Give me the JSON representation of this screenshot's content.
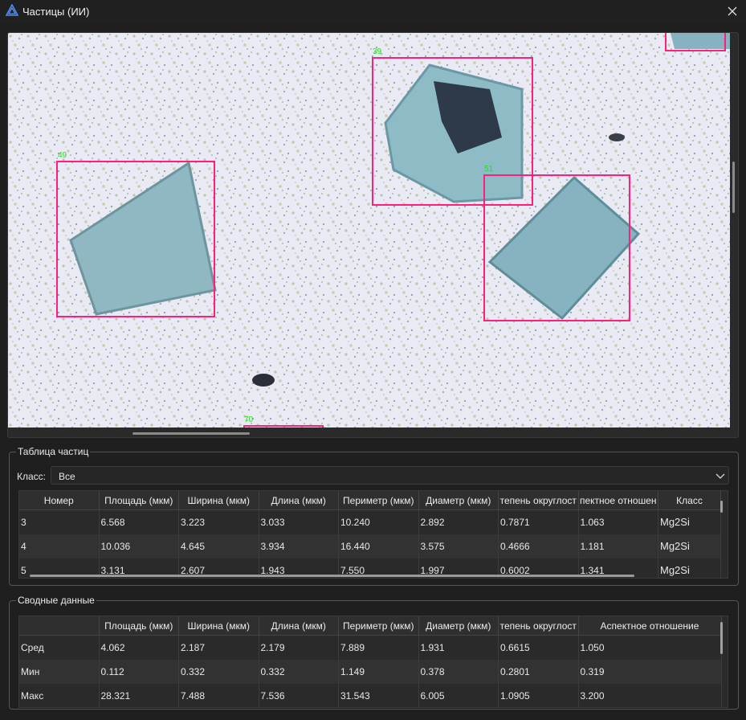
{
  "window": {
    "title": "Частицы (ИИ)"
  },
  "viewer": {
    "detections": [
      {
        "label": "39",
        "name": "detection-box-39"
      },
      {
        "label": "49",
        "name": "detection-box-49"
      },
      {
        "label": "51",
        "name": "detection-box-51"
      },
      {
        "label": "70",
        "name": "detection-box-70"
      }
    ],
    "box_color": "#ff1f7a",
    "label_color": "#22dd22"
  },
  "particle_table": {
    "group_title": "Таблица частиц",
    "class_label": "Класс:",
    "class_value": "Все",
    "columns": [
      "Номер",
      "Площадь (мкм)",
      "Ширина (мкм)",
      "Длина (мкм)",
      "Периметр (мкм)",
      "Диаметр (мкм)",
      "тепень округлост",
      "пектное отношен",
      "Класс"
    ],
    "rows": [
      [
        "3",
        "6.568",
        "3.223",
        "3.033",
        "10.240",
        "2.892",
        "0.7871",
        "1.063",
        "Mg2Si"
      ],
      [
        "4",
        "10.036",
        "4.645",
        "3.934",
        "16.440",
        "3.575",
        "0.4666",
        "1.181",
        "Mg2Si"
      ],
      [
        "5",
        "3.131",
        "2.607",
        "1.943",
        "7.550",
        "1.997",
        "0.6002",
        "1.341",
        "Mg2Si"
      ]
    ]
  },
  "summary": {
    "group_title": "Сводные данные",
    "columns": [
      "",
      "Площадь (мкм)",
      "Ширина (мкм)",
      "Длина (мкм)",
      "Периметр (мкм)",
      "Диаметр (мкм)",
      "тепень округлост",
      "Аспектное отношение"
    ],
    "rows": [
      [
        "Сред",
        "4.062",
        "2.187",
        "2.179",
        "7.889",
        "1.931",
        "0.6615",
        "1.050"
      ],
      [
        "Мин",
        "0.112",
        "0.332",
        "0.332",
        "1.149",
        "0.378",
        "0.2801",
        "0.319"
      ],
      [
        "Макс",
        "28.321",
        "7.488",
        "7.536",
        "31.543",
        "6.005",
        "1.0905",
        "3.200"
      ]
    ]
  }
}
